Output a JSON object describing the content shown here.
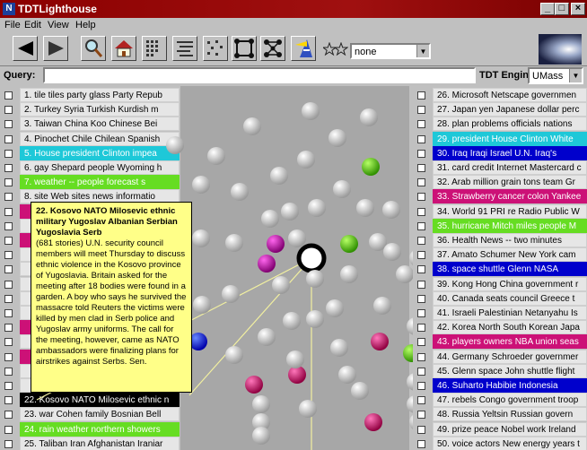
{
  "window": {
    "title": "TDTLighthouse",
    "app_icon_glyph": "N",
    "controls": {
      "minimize": "_",
      "maximize": "□",
      "close": "×"
    }
  },
  "menu": [
    "File",
    "Edit",
    "View",
    "Help"
  ],
  "toolbar": {
    "icons": [
      "back-arrow-icon",
      "forward-arrow-icon",
      "magnify-icon",
      "home-icon",
      "grid-view-icon",
      "list-view-icon",
      "scatter-view-icon",
      "cube-icon",
      "network-icon",
      "lighthouse-icon",
      "stars-icon"
    ],
    "select_value": "none"
  },
  "query": {
    "label": "Query:",
    "value": "",
    "engine_label": "TDT Engine:",
    "engine_value": "UMass"
  },
  "colors": {
    "cyan": "#1ec8d8",
    "green": "#66dd22",
    "blue": "#0000cc",
    "magenta": "#cc1177",
    "purple": "#aa0099",
    "highlight_pink": "#ee0077"
  },
  "left_list": [
    {
      "text": "1. tile tiles party glass Party Repub",
      "hl": ""
    },
    {
      "text": "2. Turkey Syria Turkish Kurdish m",
      "hl": ""
    },
    {
      "text": "3. Taiwan China Koo Chinese Bei",
      "hl": ""
    },
    {
      "text": "4. Pinochet Chile Chilean Spanish",
      "hl": ""
    },
    {
      "text": "5. House president Clinton impea",
      "hl": "cyan"
    },
    {
      "text": "6. gay Shepard people Wyoming h",
      "hl": ""
    },
    {
      "text": "7. weather -- people forecast s",
      "hl": "green"
    },
    {
      "text": "8. site Web sites news informatio",
      "hl": ""
    },
    {
      "text": "",
      "hl": "magenta"
    },
    {
      "text": "",
      "hl": ""
    },
    {
      "text": "",
      "hl": "magenta"
    },
    {
      "text": "",
      "hl": ""
    },
    {
      "text": "",
      "hl": ""
    },
    {
      "text": "",
      "hl": ""
    },
    {
      "text": "",
      "hl": ""
    },
    {
      "text": "",
      "hl": ""
    },
    {
      "text": "",
      "hl": "magenta"
    },
    {
      "text": "",
      "hl": ""
    },
    {
      "text": "",
      "hl": "magenta"
    },
    {
      "text": "",
      "hl": ""
    },
    {
      "text": "",
      "hl": ""
    },
    {
      "text": "22. Kosovo NATO Milosevic ethnic n",
      "hl": "black"
    },
    {
      "text": "23. war Cohen family Bosnian Bell",
      "hl": ""
    },
    {
      "text": "24. rain weather northern showers",
      "hl": "green"
    },
    {
      "text": "25. Taliban Iran Afghanistan Iraniar",
      "hl": ""
    }
  ],
  "right_list": [
    {
      "text": "26. Microsoft Netscape governmen",
      "hl": ""
    },
    {
      "text": "27. Japan yen Japanese dollar perc",
      "hl": ""
    },
    {
      "text": "28. plan problems officials nations",
      "hl": ""
    },
    {
      "text": "29. president House Clinton White",
      "hl": "cyan"
    },
    {
      "text": "30. Iraq Iraqi Israel U.N. Iraq's",
      "hl": "blue"
    },
    {
      "text": "31. card credit Internet Mastercard c",
      "hl": ""
    },
    {
      "text": "32. Arab million grain tons team Gr",
      "hl": ""
    },
    {
      "text": "33. Strawberry cancer colon Yankee",
      "hl": "magenta"
    },
    {
      "text": "34. World 91 PRI re Radio Public W",
      "hl": ""
    },
    {
      "text": "35. hurricane Mitch miles people M",
      "hl": "green"
    },
    {
      "text": "36. Health News -- two minutes",
      "hl": ""
    },
    {
      "text": "37. Amato Schumer New York cam",
      "hl": ""
    },
    {
      "text": "38. space shuttle Glenn NASA",
      "hl": "blue"
    },
    {
      "text": "39. Kong Hong China government r",
      "hl": ""
    },
    {
      "text": "40. Canada seats council Greece t",
      "hl": ""
    },
    {
      "text": "41. Israeli Palestinian Netanyahu Is",
      "hl": ""
    },
    {
      "text": "42. Korea North South Korean Japa",
      "hl": ""
    },
    {
      "text": "43. players owners NBA union seas",
      "hl": "magenta"
    },
    {
      "text": "44. Germany Schroeder governmer",
      "hl": ""
    },
    {
      "text": "45. Glenn space John shuttle flight",
      "hl": ""
    },
    {
      "text": "46. Suharto Habibie Indonesia",
      "hl": "blue"
    },
    {
      "text": "47. rebels Congo government troop",
      "hl": ""
    },
    {
      "text": "48. Russia Yeltsin Russian govern",
      "hl": ""
    },
    {
      "text": "49. prize peace Nobel work Ireland",
      "hl": ""
    },
    {
      "text": "50. voice actors New energy years t",
      "hl": ""
    }
  ],
  "tooltip": {
    "title": "22. Kosovo NATO Milosevic ethnic military Yugoslav Albanian Serbian Yugoslavia Serb",
    "body": "(681 stories) U.N. security council members will meet Thursday to discuss ethnic violence in the Kosovo province of Yugoslavia. Britain asked for the meeting after 18 bodies were found in a garden. A boy who says he survived the massacre told Reuters the victims were killed by men clad in Serb police and Yugoslav army uniforms. The call for the meeting, however, came as NATO ambassadors were finalizing plans for airstrikes against Serbs. Sen."
  },
  "spheres": [
    {
      "c": "white"
    },
    {
      "c": "white"
    },
    {
      "c": "white"
    },
    {
      "c": "white"
    },
    {
      "c": "white"
    },
    {
      "c": "white"
    },
    {
      "c": "green"
    },
    {
      "c": "white"
    },
    {
      "c": "white"
    },
    {
      "c": "white"
    },
    {
      "c": "white"
    },
    {
      "c": "white"
    },
    {
      "c": "white"
    },
    {
      "c": "white"
    },
    {
      "c": "white"
    },
    {
      "c": "white"
    },
    {
      "c": "white"
    },
    {
      "c": "white"
    },
    {
      "c": "white"
    },
    {
      "c": "white"
    },
    {
      "c": "purple"
    },
    {
      "c": "purple"
    },
    {
      "c": "selected"
    },
    {
      "c": "green"
    },
    {
      "c": "white"
    },
    {
      "c": "white"
    },
    {
      "c": "white"
    },
    {
      "c": "white"
    },
    {
      "c": "white"
    },
    {
      "c": "white"
    },
    {
      "c": "white"
    },
    {
      "c": "white"
    },
    {
      "c": "white"
    },
    {
      "c": "white"
    },
    {
      "c": "white"
    },
    {
      "c": "white"
    },
    {
      "c": "white"
    },
    {
      "c": "white"
    },
    {
      "c": "magenta"
    },
    {
      "c": "white"
    },
    {
      "c": "white"
    },
    {
      "c": "green"
    },
    {
      "c": "magenta"
    },
    {
      "c": "white"
    },
    {
      "c": "white"
    },
    {
      "c": "magenta"
    },
    {
      "c": "magenta"
    },
    {
      "c": "white"
    },
    {
      "c": "white"
    },
    {
      "c": "white"
    },
    {
      "c": "white"
    },
    {
      "c": "white"
    },
    {
      "c": "white"
    },
    {
      "c": "white"
    },
    {
      "c": "white"
    },
    {
      "c": "white"
    },
    {
      "c": "white"
    },
    {
      "c": "blue"
    }
  ]
}
